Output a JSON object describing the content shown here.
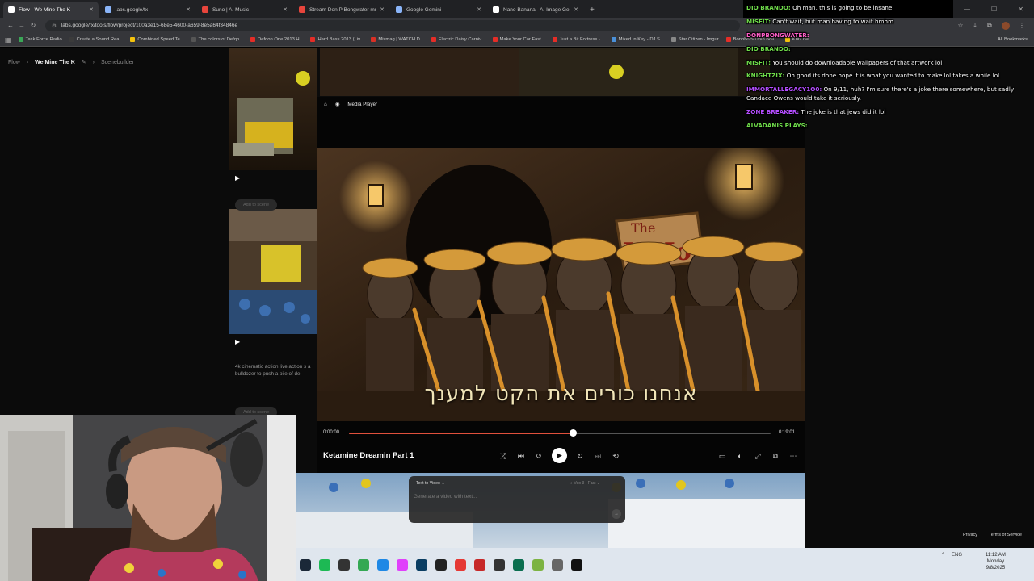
{
  "browser": {
    "tabs": [
      {
        "title": "Flow - We Mine The K",
        "color": "#ffffff",
        "active": true
      },
      {
        "title": "labs.google/fx",
        "color": "#8ab4f8",
        "active": false
      },
      {
        "title": "Suno | AI Music",
        "color": "#e8453c",
        "active": false
      },
      {
        "title": "Stream Don P Bongwater music",
        "color": "#e8453c",
        "active": false
      },
      {
        "title": "Google Gemini",
        "color": "#8ab4f8",
        "active": false
      },
      {
        "title": "Nano Banana - AI Image Gene",
        "color": "#ffffff",
        "active": false
      }
    ],
    "new_tab_icon": "+",
    "url": "labs.google/fx/tools/flow/project/100a3e15-68e5-4600-a659-8e5a64f34846e",
    "bookmarks": [
      {
        "label": "Task Force Radio",
        "color": "#3aa757"
      },
      {
        "label": "Create a Sound Rea...",
        "color": "#3b3b3b"
      },
      {
        "label": "Combined Speed Te...",
        "color": "#f4c20d"
      },
      {
        "label": "The colors of Defqo...",
        "color": "#555555"
      },
      {
        "label": "Defqon One 2013 H...",
        "color": "#e52d27"
      },
      {
        "label": "Hard Bass 2013 (Liv...",
        "color": "#e52d27"
      },
      {
        "label": "Mixmag | WATCH D...",
        "color": "#d93025"
      },
      {
        "label": "Electric Daisy Carniv...",
        "color": "#e52d27"
      },
      {
        "label": "Make Your Car Fast...",
        "color": "#e52d27"
      },
      {
        "label": "Just a Bit Fortress -...",
        "color": "#e52d27"
      },
      {
        "label": "Mixed In Key - DJ S...",
        "color": "#4a90d9"
      },
      {
        "label": "Star Citizen - Imgur",
        "color": "#888888"
      },
      {
        "label": "Bonobo 50 min Boil...",
        "color": "#e52d27"
      },
      {
        "label": "Kritz.net",
        "color": "#f4c20d"
      }
    ],
    "all_bookmarks": "All Bookmarks"
  },
  "flow": {
    "breadcrumb": [
      "Flow",
      "We Mine The K",
      "Scenebuilder"
    ],
    "add_to_scene": "Add to scene",
    "clip_description": "4k cinematic action live action s a bulldozer to push a pile of de"
  },
  "player": {
    "header_label": "Media Player",
    "time_current": "0:00:00",
    "time_total": "0:19:01",
    "progress": 0.53,
    "title": "Ketamine Dreamin Part 1",
    "subtitle": "אנחנו כורים את הקט למענך",
    "sign_text": "The\nK Hole"
  },
  "prompt": {
    "mode": "Text to Video",
    "model": "Veo 3 - Fast",
    "placeholder": "Generate a video with text..."
  },
  "footer": {
    "privacy": "Privacy",
    "terms": "Terms of Service"
  },
  "chat": [
    {
      "user": "Dio Brando:",
      "text": "Oh man, this is going to be insane",
      "color": "#6fdc4a"
    },
    {
      "user": "Misfit:",
      "text": "Can't wait, but man having to wait.hmhm",
      "color": "#6fdc4a"
    },
    {
      "user": "DonPBongwater:",
      "text": "",
      "color": "#ff5ec8"
    },
    {
      "user": "Dio Brando:",
      "text": "",
      "color": "#6fdc4a"
    },
    {
      "user": "Misfit:",
      "text": "You should do downloadable wallpapers of that artwork lol",
      "color": "#6fdc4a"
    },
    {
      "user": "Knightzix:",
      "text": "Oh good its done hope it is what you wanted to make lol takes a while lol",
      "color": "#6fdc4a"
    },
    {
      "user": "ImmortalLegacy1O0:",
      "text": "On 9/11, huh? I'm sure there's a joke there somewhere, but sadly Candace Owens would take it seriously.",
      "color": "#b44dff"
    },
    {
      "user": "Zone Breaker:",
      "text": "The joke is that jews did it lol",
      "color": "#b44dff"
    },
    {
      "user": "Alvadanis Plays:",
      "text": "",
      "color": "#6fdc4a"
    }
  ],
  "taskbar": {
    "icons": [
      "steam-icon",
      "spotify-icon",
      "app-icon",
      "chrome-icon",
      "edge-icon",
      "paint-icon",
      "photoshop-icon",
      "notion-icon",
      "opera-icon",
      "app-icon",
      "app-icon",
      "app-icon",
      "app-icon",
      "settings-icon",
      "obs-icon"
    ],
    "lang": "ENG",
    "time": "11:12 AM",
    "day": "Monday",
    "date": "9/8/2025"
  }
}
